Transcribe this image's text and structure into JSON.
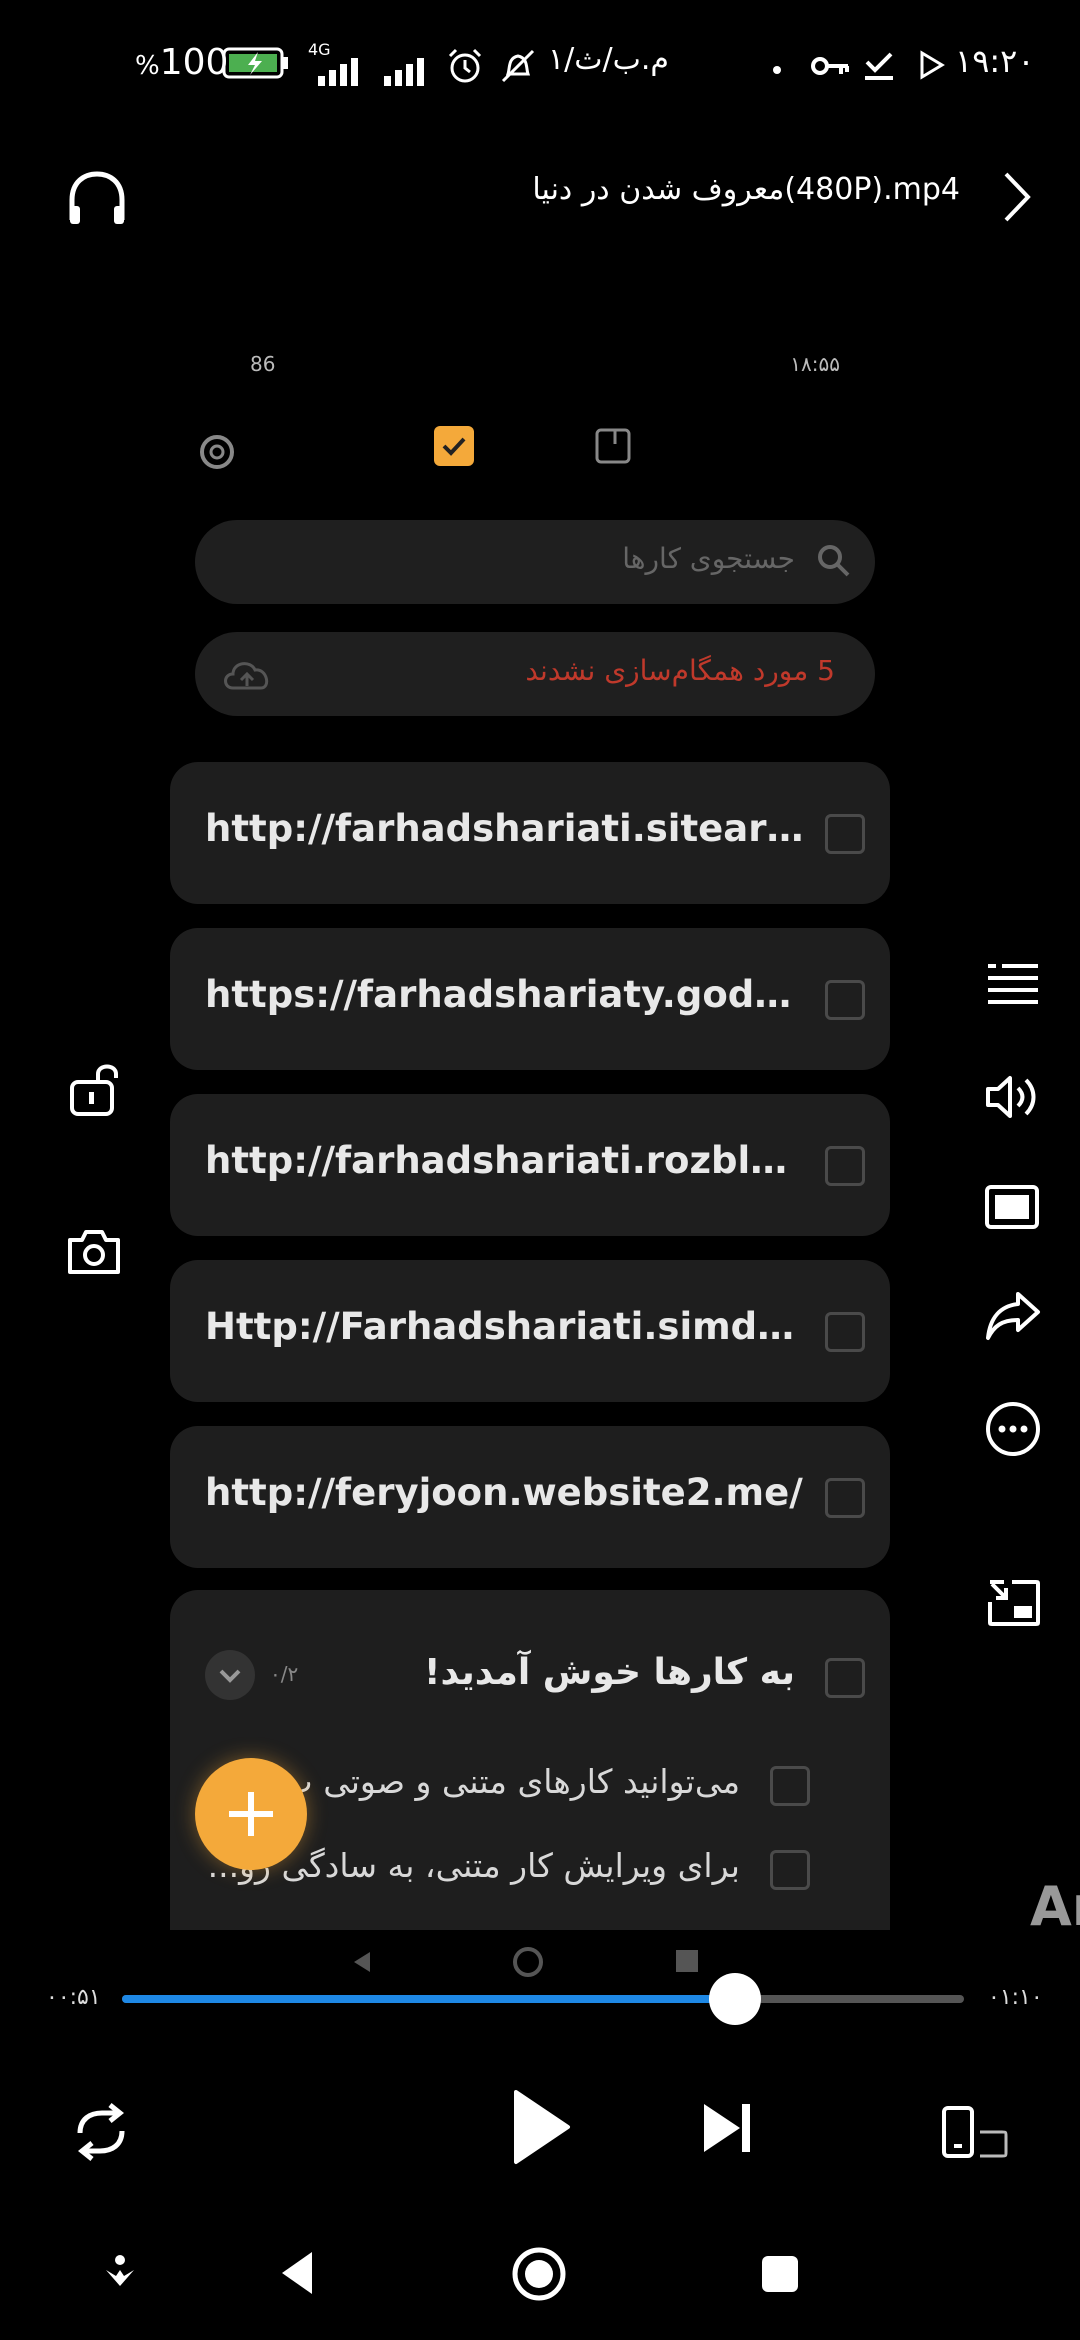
{
  "status_bar": {
    "time": "۱۹:۲۰",
    "date": "۱/م.ب/ث",
    "network": "4G",
    "battery": "100",
    "battery_suffix": "%"
  },
  "header": {
    "title": "معروف شدن در دنیا(480P).mp4"
  },
  "video_content": {
    "inner_status": {
      "time": "۱۸:۵۵",
      "battery": "86"
    },
    "search_placeholder": "جستجوی کارها",
    "sync_message": "5 مورد همگام‌سازی نشدند",
    "tasks": [
      "http://farhadshariati.sitearia.ir/",
      "https://farhadshariaty.godaddysi...",
      "http://farhadshariati.rozblog.com",
      "Http://Farhadshariati.simdif.com",
      "http://feryjoon.website2.me/"
    ],
    "group": {
      "title": "به کارها خوش آمدید!",
      "count": "۰/۲",
      "subtasks": [
        "می‌توانید کارهای متنی و صوتی ب",
        "برای ویرایش کار متنی، به سادگی رو..."
      ]
    },
    "watermark": "Ar"
  },
  "player": {
    "elapsed": "۰۰:۵۱",
    "duration": "۰۱:۱۰",
    "progress": 0.728
  },
  "colors": {
    "accent": "#1e88e5",
    "fab": "#f4a93a",
    "sync_error": "#c0392b"
  }
}
